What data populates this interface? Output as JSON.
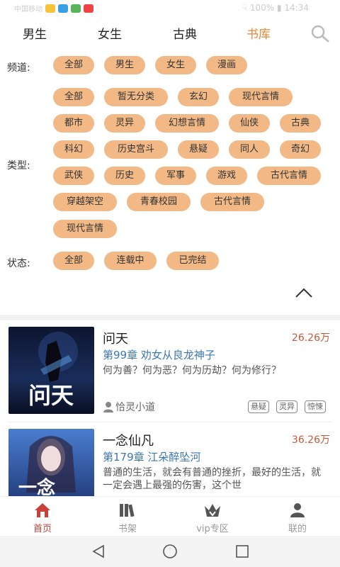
{
  "status_bar": {
    "carrier": "中国移动",
    "right_text": "☟ 100% ▮ 14:34"
  },
  "top_tabs": [
    "男生",
    "女生",
    "古典",
    "书库"
  ],
  "active_tab": "书库",
  "filters": {
    "channel_label": "频道:",
    "channels": [
      "全部",
      "男生",
      "女生",
      "漫画"
    ],
    "type_label": "类型:",
    "types": [
      "全部",
      "暂无分类",
      "玄幻",
      "现代言情",
      "都市",
      "灵异",
      "幻想言情",
      "仙侠",
      "古典",
      "科幻",
      "历史宫斗",
      "悬疑",
      "同人",
      "奇幻",
      "武侠",
      "历史",
      "军事",
      "游戏",
      "古代言情",
      "穿越架空",
      "青春校园",
      "古代言情",
      "现代言情"
    ],
    "status_label": "状态:",
    "statuses": [
      "全部",
      "连载中",
      "已完结"
    ]
  },
  "books": [
    {
      "title": "问天",
      "count": "26.26万",
      "chapter": "第99章 劝女从良龙神子",
      "desc": "何为善？何为恶？何为历劫？何为修行？",
      "author": "恰灵小道",
      "tags": [
        "悬疑",
        "灵异",
        "惊悚"
      ],
      "cover_text": "问天"
    },
    {
      "title": "一念仙凡",
      "count": "36.26万",
      "chapter": "第179章 江朵醉坠河",
      "desc": "普通的生活，就会有普通的挫折，最好的生活，就一定会遇上最强的伤害，这个世",
      "author": "",
      "tags": [],
      "cover_text": "一念"
    }
  ],
  "bottom_nav": [
    "首页",
    "书架",
    "vip专区",
    "联的"
  ],
  "active_nav": "首页",
  "colors": {
    "accent": "#e3893a",
    "tag_bg": "#f2b986",
    "count": "#c85a3c",
    "chapter": "#3b78b5",
    "nav_active": "#c8423a"
  }
}
